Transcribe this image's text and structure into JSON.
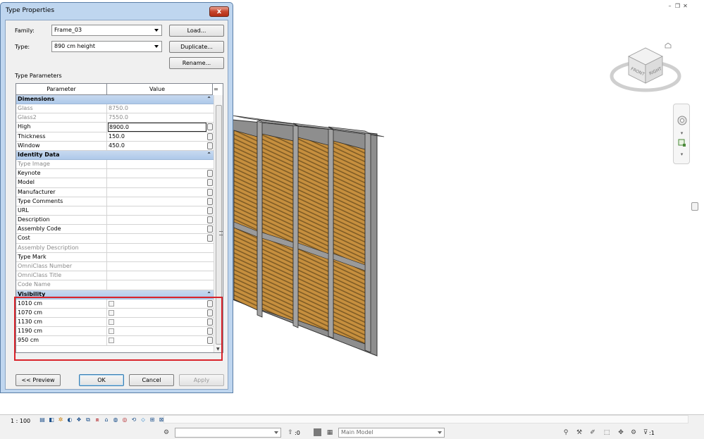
{
  "dialog": {
    "title": "Type Properties",
    "close_glyph": "x",
    "family_label": "Family:",
    "family_value": "Frame_03",
    "type_label": "Type:",
    "type_value": "890 cm height",
    "load_label": "Load...",
    "duplicate_label": "Duplicate...",
    "rename_label": "Rename...",
    "type_parameters_label": "Type Parameters",
    "columns": [
      "Parameter",
      "Value"
    ],
    "grid_menu_glyph": "=",
    "groups": [
      {
        "name": "Dimensions",
        "rows": [
          {
            "name": "Glass",
            "value": "8750.0",
            "dim": true,
            "edit": false
          },
          {
            "name": "Glass2",
            "value": "7550.0",
            "dim": true,
            "edit": false
          },
          {
            "name": "High",
            "value": "8900.0",
            "dim": false,
            "edit": true,
            "active": true
          },
          {
            "name": "Thickness",
            "value": "150.0",
            "dim": false,
            "edit": true
          },
          {
            "name": "Window",
            "value": "450.0",
            "dim": false,
            "edit": true
          }
        ]
      },
      {
        "name": "Identity Data",
        "rows": [
          {
            "name": "Type Image",
            "value": "",
            "dim": true,
            "edit": false
          },
          {
            "name": "Keynote",
            "value": "",
            "dim": false,
            "edit": true
          },
          {
            "name": "Model",
            "value": "",
            "dim": false,
            "edit": true
          },
          {
            "name": "Manufacturer",
            "value": "",
            "dim": false,
            "edit": true
          },
          {
            "name": "Type Comments",
            "value": "",
            "dim": false,
            "edit": true
          },
          {
            "name": "URL",
            "value": "",
            "dim": false,
            "edit": true
          },
          {
            "name": "Description",
            "value": "",
            "dim": false,
            "edit": true
          },
          {
            "name": "Assembly Code",
            "value": "",
            "dim": false,
            "edit": true
          },
          {
            "name": "Cost",
            "value": "",
            "dim": false,
            "edit": true
          },
          {
            "name": "Assembly Description",
            "value": "",
            "dim": true,
            "edit": false
          },
          {
            "name": "Type Mark",
            "value": "",
            "dim": false,
            "edit": false
          },
          {
            "name": "OmniClass Number",
            "value": "",
            "dim": true,
            "edit": false
          },
          {
            "name": "OmniClass Title",
            "value": "",
            "dim": true,
            "edit": false
          },
          {
            "name": "Code Name",
            "value": "",
            "dim": true,
            "edit": false
          }
        ]
      },
      {
        "name": "Visibility",
        "rows": [
          {
            "name": "1010 cm",
            "checkbox": true,
            "checked": false,
            "edit": true
          },
          {
            "name": "1070 cm",
            "checkbox": true,
            "checked": false,
            "edit": true
          },
          {
            "name": "1130 cm",
            "checkbox": true,
            "checked": false,
            "edit": true
          },
          {
            "name": "1190 cm",
            "checkbox": true,
            "checked": false,
            "edit": true
          },
          {
            "name": "950 cm",
            "checkbox": true,
            "checked": false,
            "edit": true
          }
        ]
      }
    ],
    "preview_label": "<< Preview",
    "ok_label": "OK",
    "cancel_label": "Cancel",
    "apply_label": "Apply"
  },
  "viewcube": {
    "front": "FRONT",
    "right": "RIGHT"
  },
  "statusbar": {
    "scale": "1 : 100",
    "selection_count": ":0",
    "workset": "Main Model",
    "filter_count": ":1"
  },
  "colors": {
    "accent_highlight": "#d9232a",
    "wood": "#c8913f",
    "frame": "#8c8c8c",
    "group_header": "#b9d0ec"
  }
}
